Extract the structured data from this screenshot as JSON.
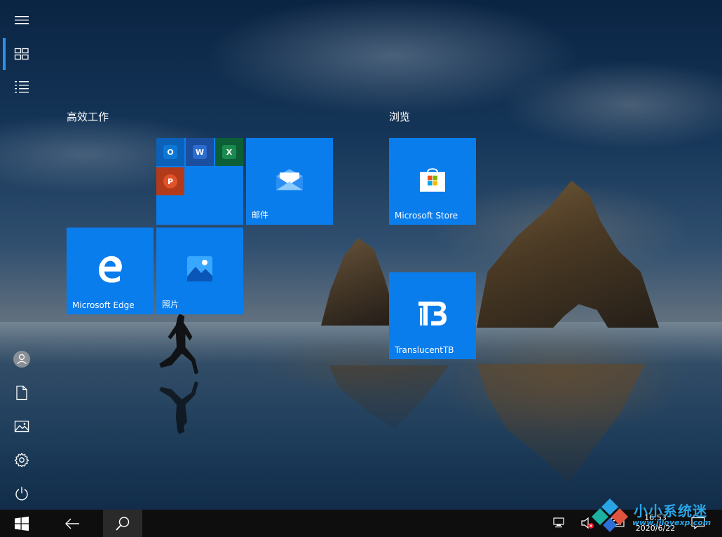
{
  "groups": [
    {
      "title": "高效工作"
    },
    {
      "title": "浏览"
    }
  ],
  "tiles": {
    "mail": {
      "label": "邮件"
    },
    "edge": {
      "label": "Microsoft Edge"
    },
    "photos": {
      "label": "照片"
    },
    "store": {
      "label": "Microsoft Store"
    },
    "translucenttb": {
      "label": "TranslucentTB"
    }
  },
  "office_folder": {
    "apps": [
      {
        "name": "Outlook",
        "letter": "O",
        "color": "#0f5db8"
      },
      {
        "name": "Word",
        "letter": "W",
        "color": "#1d55a8"
      },
      {
        "name": "Excel",
        "letter": "X",
        "color": "#127340"
      },
      {
        "name": "PowerPoint",
        "letter": "P",
        "color": "#c43b1c"
      }
    ]
  },
  "taskbar": {
    "time": "16:53",
    "date": "2020/6/22"
  },
  "watermark": {
    "text": "小小系统迷",
    "url": "www.jiloyexp.com"
  },
  "colors": {
    "tile": "#0a7ded",
    "accent": "#2f8eea",
    "taskbar": "#0e0e0e"
  }
}
